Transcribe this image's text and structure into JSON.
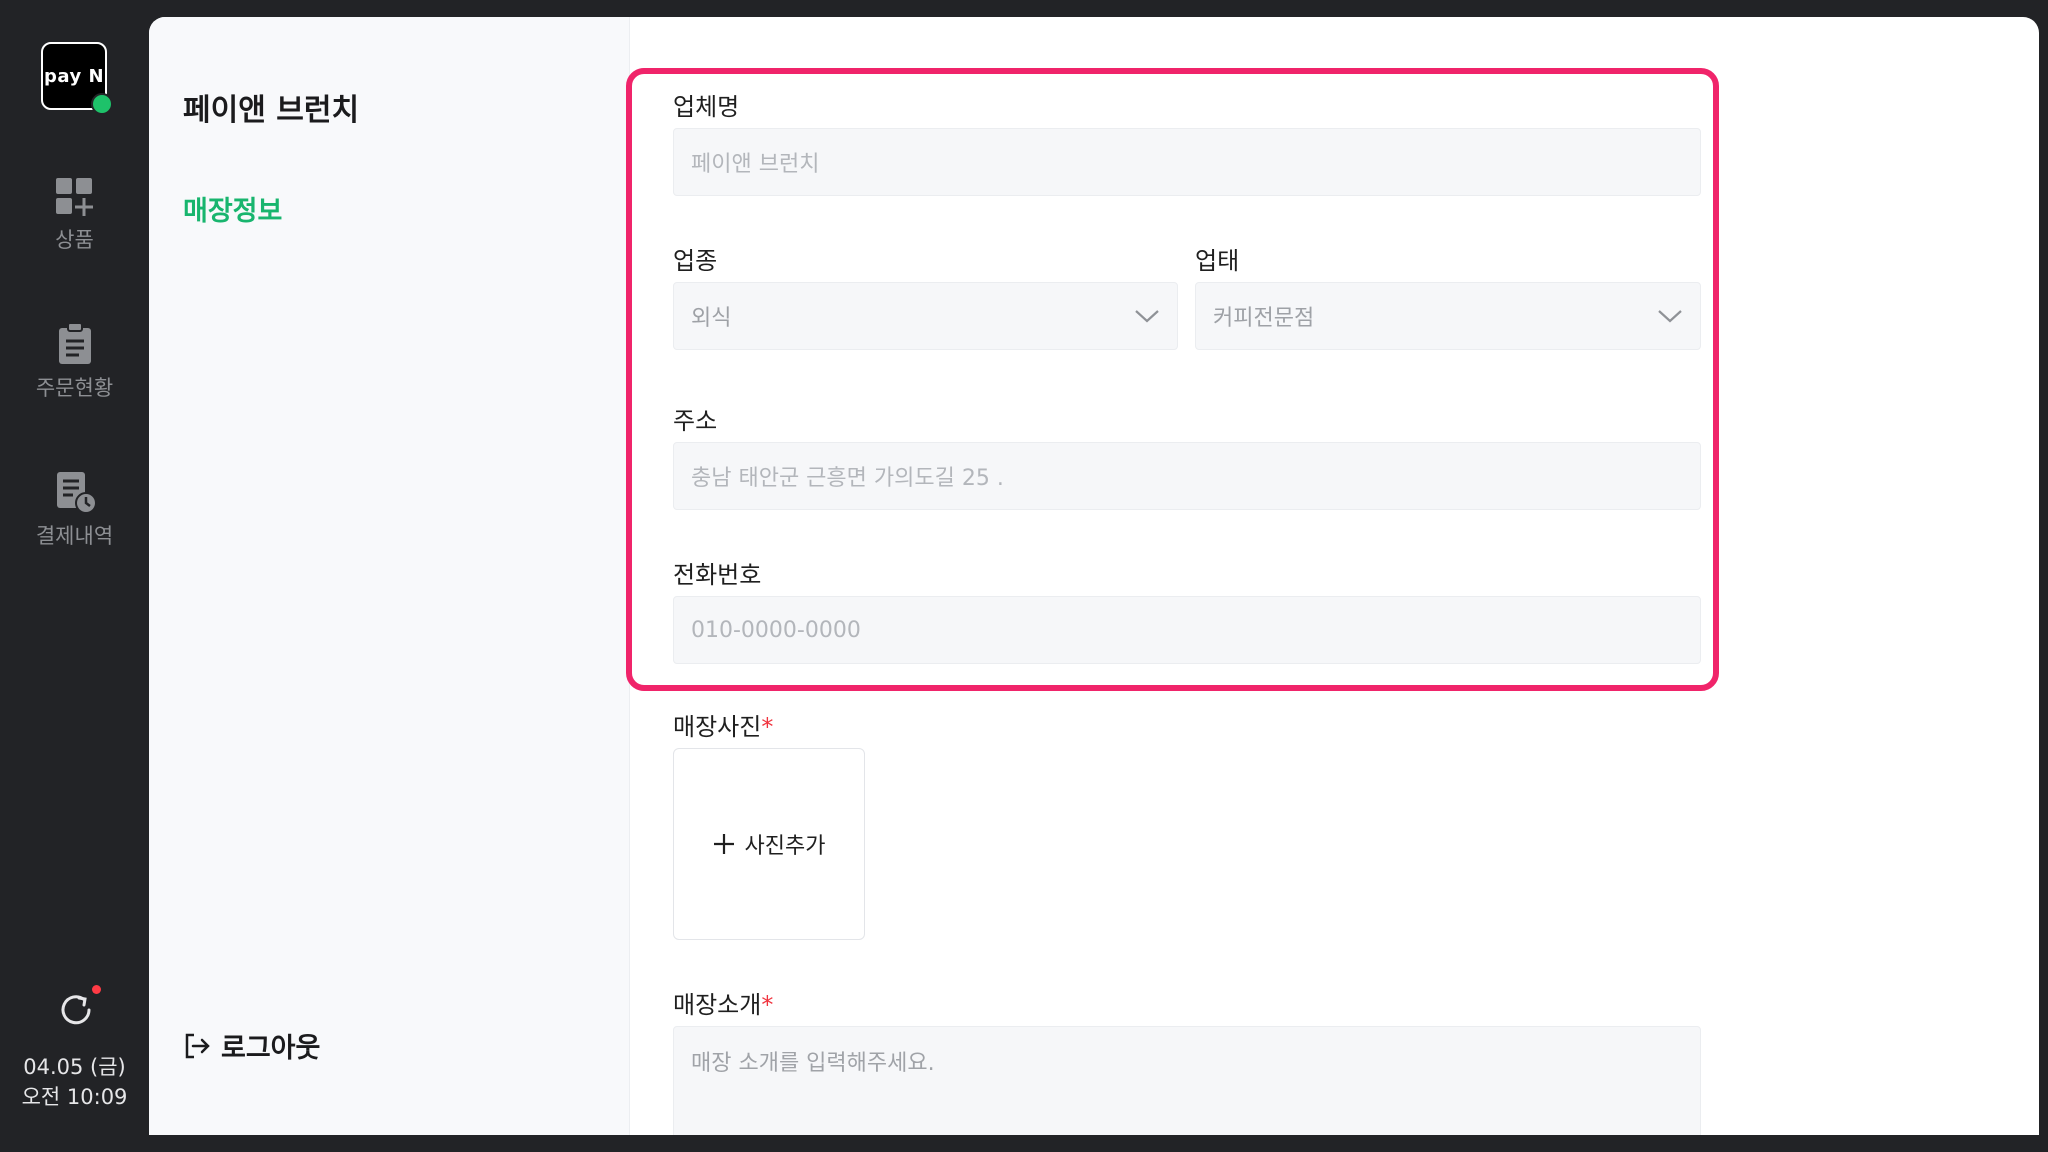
{
  "rail": {
    "logo": "pay N",
    "items": [
      {
        "label": "상품",
        "icon": "product-grid-add-icon"
      },
      {
        "label": "주문현황",
        "icon": "clipboard-icon"
      },
      {
        "label": "결제내역",
        "icon": "receipt-clock-icon"
      }
    ],
    "date": "04.05 (금)",
    "time": "오전 10:09"
  },
  "side": {
    "store_name": "페이앤 브런치",
    "active_menu": "매장정보",
    "logout": "로그아웃"
  },
  "form": {
    "business_name": {
      "label": "업체명",
      "placeholder": "페이앤 브런치"
    },
    "industry": {
      "label": "업종",
      "value": "외식"
    },
    "business_type": {
      "label": "업태",
      "value": "커피전문점"
    },
    "address": {
      "label": "주소",
      "placeholder": "충남 태안군 근흥면 가의도길 25 ."
    },
    "phone": {
      "label": "전화번호",
      "placeholder": "010-0000-0000"
    },
    "photo": {
      "label": "매장사진",
      "required_mark": "*",
      "add_label": "사진추가"
    },
    "intro": {
      "label": "매장소개",
      "required_mark": "*",
      "placeholder": "매장 소개를 입력해주세요."
    }
  },
  "colors": {
    "accent": "#18b56e",
    "highlight": "#f0246a",
    "required": "#f0343f",
    "rail_bg": "#222326"
  }
}
